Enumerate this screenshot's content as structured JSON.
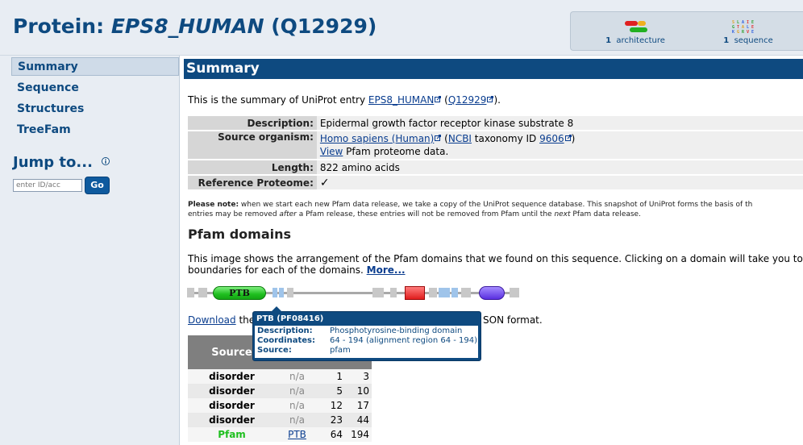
{
  "header": {
    "title_prefix": "Protein: ",
    "title_name": "EPS8_HUMAN",
    "title_acc": " (Q12929)",
    "icons": [
      {
        "count": "1",
        "label": "architecture",
        "icon": "architecture-icon"
      },
      {
        "count": "1",
        "label": "sequence",
        "icon": "sequence-icon"
      }
    ]
  },
  "sidebar": {
    "items": [
      {
        "label": "Summary",
        "active": true
      },
      {
        "label": "Sequence"
      },
      {
        "label": "Structures"
      },
      {
        "label": "TreeFam"
      }
    ],
    "jump_title": "Jump to...",
    "jump_placeholder": "enter ID/acc",
    "go_label": "Go"
  },
  "summary": {
    "heading": "Summary",
    "intro_pre": "This is the summary of UniProt entry ",
    "intro_id": "EPS8_HUMAN",
    "intro_mid": " (",
    "intro_acc": "Q12929",
    "intro_post": ").",
    "rows": {
      "description_key": "Description:",
      "description_val": "Epidermal growth factor receptor kinase substrate 8",
      "organism_key": "Source organism:",
      "organism_link": "Homo sapiens (Human)",
      "organism_ncbi_pre": " (",
      "organism_ncbi": "NCBI",
      "organism_tax": " taxonomy ID ",
      "organism_taxid": "9606",
      "organism_post": ")",
      "view_link": "View",
      "view_rest": " Pfam proteome data.",
      "length_key": "Length:",
      "length_val": "822 amino acids",
      "refprot_key": "Reference Proteome:",
      "refprot_val": "✓"
    },
    "note_bold": "Please note:",
    "note_line1": " when we start each new Pfam data release, we take a copy of the UniProt sequence database. This snapshot of UniProt forms the basis of th",
    "note_line2_pre": "entries may be removed ",
    "note_line2_em1": "after",
    "note_line2_mid": " a Pfam release, these entries will not be removed from Pfam until the ",
    "note_line2_em2": "next",
    "note_line2_post": " Pfam data release."
  },
  "pfam": {
    "heading": "Pfam domains",
    "line1": "This image shows the arrangement of the Pfam domains that we found on this sequence. Clicking on a domain will take you to th",
    "line2": "boundaries for each of the domains. ",
    "more": "More...",
    "domain_label": "PTB",
    "download": "Download",
    "download_rest_a": " the",
    "download_rest_b": "SON format.",
    "table_head_source": "Source",
    "rows": [
      {
        "source": "disorder",
        "entry": "n/a",
        "start": "1",
        "end": "3",
        "pfam": false
      },
      {
        "source": "disorder",
        "entry": "n/a",
        "start": "5",
        "end": "10",
        "pfam": false
      },
      {
        "source": "disorder",
        "entry": "n/a",
        "start": "12",
        "end": "17",
        "pfam": false
      },
      {
        "source": "disorder",
        "entry": "n/a",
        "start": "23",
        "end": "44",
        "pfam": false
      },
      {
        "source": "Pfam",
        "entry": "PTB",
        "start": "64",
        "end": "194",
        "pfam": true
      }
    ]
  },
  "tooltip": {
    "title": "PTB (PF08416)",
    "desc_key": "Description:",
    "desc_val": "Phosphotyrosine-binding domain",
    "coord_key": "Coordinates:",
    "coord_val": "64 - 194 (alignment region 64 - 194)",
    "source_key": "Source:",
    "source_val": "pfam"
  },
  "colors": {
    "brand": "#0e4a80",
    "pfam_green": "#1fbf1f",
    "link": "#0a3d8f"
  }
}
